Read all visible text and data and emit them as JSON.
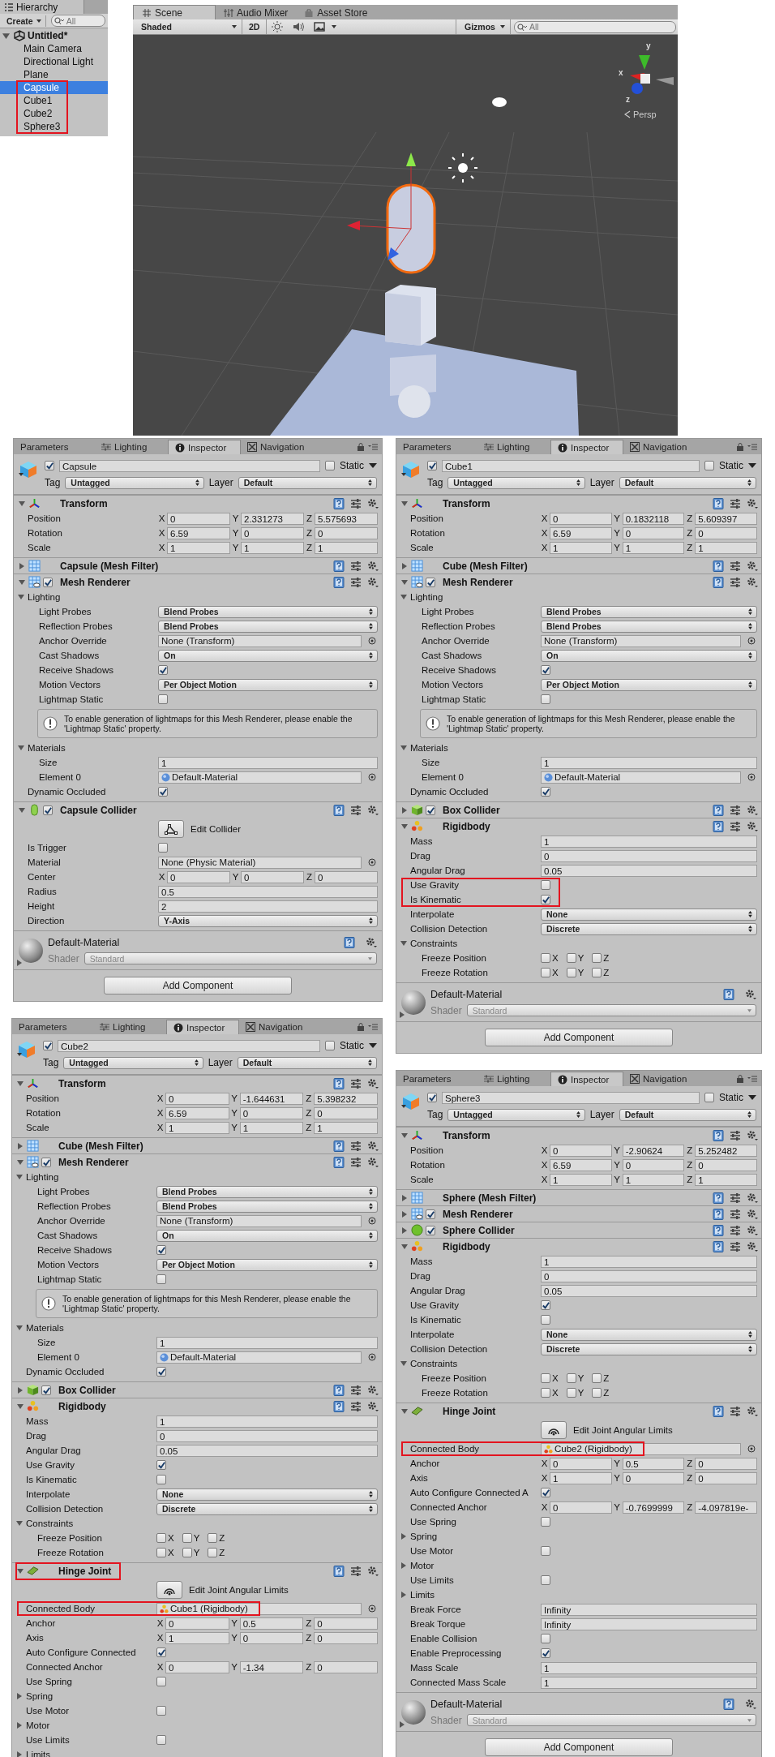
{
  "hierarchy": {
    "title": "Hierarchy",
    "create": "Create",
    "search_placeholder": "All",
    "tree": [
      {
        "label": "Untitled*",
        "expanded": true,
        "selected": false,
        "highlighted": false,
        "children": [
          {
            "label": "Main Camera",
            "selected": false,
            "highlighted": false
          },
          {
            "label": "Directional Light",
            "selected": false,
            "highlighted": false
          },
          {
            "label": "Plane",
            "selected": false,
            "highlighted": false
          },
          {
            "label": "Capsule",
            "selected": true,
            "highlighted": true
          },
          {
            "label": "Cube1",
            "selected": false,
            "highlighted": true
          },
          {
            "label": "Cube2",
            "selected": false,
            "highlighted": true
          },
          {
            "label": "Sphere3",
            "selected": false,
            "highlighted": true
          }
        ]
      }
    ]
  },
  "scene": {
    "tabs": [
      {
        "label": "Scene",
        "selected": true
      },
      {
        "label": "Audio Mixer",
        "selected": false
      },
      {
        "label": "Asset Store",
        "selected": false
      }
    ],
    "shading": "Shaded",
    "mode_2d": "2D",
    "gizmos": "Gizmos",
    "search_placeholder": "All",
    "axis_labels": [
      "y",
      "x",
      "z"
    ],
    "projection": "Persp"
  },
  "inspectors": [
    {
      "tabs": [
        {
          "label": "Parameters",
          "selected": false
        },
        {
          "label": "Lighting",
          "selected": false
        },
        {
          "label": "Inspector",
          "selected": true
        },
        {
          "label": "Navigation",
          "selected": false
        }
      ],
      "object": {
        "active": true,
        "name": "Capsule",
        "static": false,
        "static_label": "Static",
        "tag_label": "Tag",
        "tag": "Untagged",
        "layer_label": "Layer",
        "layer": "Default"
      },
      "components": [
        {
          "kind": "transform",
          "title": "Transform",
          "expanded": true,
          "highlighted": false,
          "rows": [
            {
              "kind": "vector",
              "label": "Position",
              "values": [
                {
                  "axis": "X",
                  "value": "0"
                },
                {
                  "axis": "Y",
                  "value": "2.331273"
                },
                {
                  "axis": "Z",
                  "value": "5.575693"
                }
              ]
            },
            {
              "kind": "vector",
              "label": "Rotation",
              "values": [
                {
                  "axis": "X",
                  "value": "6.59"
                },
                {
                  "axis": "Y",
                  "value": "0"
                },
                {
                  "axis": "Z",
                  "value": "0"
                }
              ]
            },
            {
              "kind": "vector",
              "label": "Scale",
              "values": [
                {
                  "axis": "X",
                  "value": "1"
                },
                {
                  "axis": "Y",
                  "value": "1"
                },
                {
                  "axis": "Z",
                  "value": "1"
                }
              ]
            }
          ]
        },
        {
          "kind": "mesh_filter",
          "title": "Capsule (Mesh Filter)",
          "expanded": false,
          "highlighted": false
        },
        {
          "kind": "mesh_renderer",
          "title": "Mesh Renderer",
          "expanded": true,
          "enabled": true,
          "highlighted": false,
          "rows": [
            {
              "kind": "foldout",
              "label": "Lighting",
              "expanded": true,
              "children": [
                {
                  "kind": "dropdown",
                  "label": "Light Probes",
                  "value": "Blend Probes"
                },
                {
                  "kind": "dropdown",
                  "label": "Reflection Probes",
                  "value": "Blend Probes"
                },
                {
                  "kind": "object",
                  "label": "Anchor Override",
                  "value": "None (Transform)"
                },
                {
                  "kind": "dropdown",
                  "label": "Cast Shadows",
                  "value": "On"
                },
                {
                  "kind": "checkbox",
                  "label": "Receive Shadows",
                  "checked": true
                },
                {
                  "kind": "dropdown",
                  "label": "Motion Vectors",
                  "value": "Per Object Motion"
                },
                {
                  "kind": "checkbox",
                  "label": "Lightmap Static",
                  "checked": false
                },
                {
                  "kind": "help",
                  "text": "To enable generation of lightmaps for this Mesh Renderer, please enable the 'Lightmap Static' property."
                }
              ]
            },
            {
              "kind": "foldout",
              "label": "Materials",
              "expanded": true,
              "children": [
                {
                  "kind": "field",
                  "label": "Size",
                  "value": "1"
                },
                {
                  "kind": "material_ref",
                  "label": "Element 0",
                  "value": "Default-Material"
                }
              ]
            },
            {
              "kind": "checkbox",
              "label": "Dynamic Occluded",
              "checked": true
            }
          ]
        },
        {
          "kind": "capsule_collider",
          "title": "Capsule Collider",
          "expanded": true,
          "enabled": true,
          "highlighted": false,
          "rows": [
            {
              "kind": "edit",
              "label": "Edit Collider"
            },
            {
              "kind": "checkbox",
              "label": "Is Trigger",
              "checked": false
            },
            {
              "kind": "object",
              "label": "Material",
              "value": "None (Physic Material)"
            },
            {
              "kind": "vector",
              "label": "Center",
              "values": [
                {
                  "axis": "X",
                  "value": "0"
                },
                {
                  "axis": "Y",
                  "value": "0"
                },
                {
                  "axis": "Z",
                  "value": "0"
                }
              ]
            },
            {
              "kind": "field",
              "label": "Radius",
              "value": "0.5"
            },
            {
              "kind": "field",
              "label": "Height",
              "value": "2"
            },
            {
              "kind": "dropdown",
              "label": "Direction",
              "value": "Y-Axis"
            }
          ]
        }
      ],
      "material": {
        "name": "Default-Material",
        "shader_label": "Shader",
        "shader": "Standard"
      },
      "add_component": "Add Component"
    },
    {
      "tabs": [
        {
          "label": "Parameters",
          "selected": false
        },
        {
          "label": "Lighting",
          "selected": false
        },
        {
          "label": "Inspector",
          "selected": true
        },
        {
          "label": "Navigation",
          "selected": false
        }
      ],
      "object": {
        "active": true,
        "name": "Cube1",
        "static": false,
        "static_label": "Static",
        "tag_label": "Tag",
        "tag": "Untagged",
        "layer_label": "Layer",
        "layer": "Default"
      },
      "components": [
        {
          "kind": "transform",
          "title": "Transform",
          "expanded": true,
          "highlighted": false,
          "rows": [
            {
              "kind": "vector",
              "label": "Position",
              "values": [
                {
                  "axis": "X",
                  "value": "0"
                },
                {
                  "axis": "Y",
                  "value": "0.1832118"
                },
                {
                  "axis": "Z",
                  "value": "5.609397"
                }
              ]
            },
            {
              "kind": "vector",
              "label": "Rotation",
              "values": [
                {
                  "axis": "X",
                  "value": "6.59"
                },
                {
                  "axis": "Y",
                  "value": "0"
                },
                {
                  "axis": "Z",
                  "value": "0"
                }
              ]
            },
            {
              "kind": "vector",
              "label": "Scale",
              "values": [
                {
                  "axis": "X",
                  "value": "1"
                },
                {
                  "axis": "Y",
                  "value": "1"
                },
                {
                  "axis": "Z",
                  "value": "1"
                }
              ]
            }
          ]
        },
        {
          "kind": "mesh_filter",
          "title": "Cube (Mesh Filter)",
          "expanded": false,
          "highlighted": false
        },
        {
          "kind": "mesh_renderer",
          "title": "Mesh Renderer",
          "expanded": true,
          "enabled": true,
          "highlighted": false,
          "rows": [
            {
              "kind": "foldout",
              "label": "Lighting",
              "expanded": true,
              "children": [
                {
                  "kind": "dropdown",
                  "label": "Light Probes",
                  "value": "Blend Probes"
                },
                {
                  "kind": "dropdown",
                  "label": "Reflection Probes",
                  "value": "Blend Probes"
                },
                {
                  "kind": "object",
                  "label": "Anchor Override",
                  "value": "None (Transform)"
                },
                {
                  "kind": "dropdown",
                  "label": "Cast Shadows",
                  "value": "On"
                },
                {
                  "kind": "checkbox",
                  "label": "Receive Shadows",
                  "checked": true
                },
                {
                  "kind": "dropdown",
                  "label": "Motion Vectors",
                  "value": "Per Object Motion"
                },
                {
                  "kind": "checkbox",
                  "label": "Lightmap Static",
                  "checked": false
                },
                {
                  "kind": "help",
                  "text": "To enable generation of lightmaps for this Mesh Renderer, please enable the 'Lightmap Static' property."
                }
              ]
            },
            {
              "kind": "foldout",
              "label": "Materials",
              "expanded": true,
              "children": [
                {
                  "kind": "field",
                  "label": "Size",
                  "value": "1"
                },
                {
                  "kind": "material_ref",
                  "label": "Element 0",
                  "value": "Default-Material"
                }
              ]
            },
            {
              "kind": "checkbox",
              "label": "Dynamic Occluded",
              "checked": true
            }
          ]
        },
        {
          "kind": "box_collider",
          "title": "Box Collider",
          "expanded": false,
          "enabled": true,
          "highlighted": false
        },
        {
          "kind": "rigidbody",
          "title": "Rigidbody",
          "expanded": true,
          "highlighted": false,
          "rows": [
            {
              "kind": "field",
              "label": "Mass",
              "value": "1"
            },
            {
              "kind": "field",
              "label": "Drag",
              "value": "0"
            },
            {
              "kind": "field",
              "label": "Angular Drag",
              "value": "0.05"
            },
            {
              "kind": "checkbox",
              "label": "Use Gravity",
              "checked": false,
              "highlighted": true
            },
            {
              "kind": "checkbox",
              "label": "Is Kinematic",
              "checked": true,
              "highlighted": true
            },
            {
              "kind": "dropdown",
              "label": "Interpolate",
              "value": "None"
            },
            {
              "kind": "dropdown",
              "label": "Collision Detection",
              "value": "Discrete"
            },
            {
              "kind": "foldout",
              "label": "Constraints",
              "expanded": true,
              "children": [
                {
                  "kind": "axes",
                  "label": "Freeze Position",
                  "axes": [
                    {
                      "label": "X",
                      "checked": false
                    },
                    {
                      "label": "Y",
                      "checked": false
                    },
                    {
                      "label": "Z",
                      "checked": false
                    }
                  ]
                },
                {
                  "kind": "axes",
                  "label": "Freeze Rotation",
                  "axes": [
                    {
                      "label": "X",
                      "checked": false
                    },
                    {
                      "label": "Y",
                      "checked": false
                    },
                    {
                      "label": "Z",
                      "checked": false
                    }
                  ]
                }
              ]
            }
          ]
        }
      ],
      "material": {
        "name": "Default-Material",
        "shader_label": "Shader",
        "shader": "Standard"
      },
      "add_component": "Add Component"
    },
    {
      "tabs": [
        {
          "label": "Parameters",
          "selected": false
        },
        {
          "label": "Lighting",
          "selected": false
        },
        {
          "label": "Inspector",
          "selected": true
        },
        {
          "label": "Navigation",
          "selected": false
        }
      ],
      "object": {
        "active": true,
        "name": "Cube2",
        "static": false,
        "static_label": "Static",
        "tag_label": "Tag",
        "tag": "Untagged",
        "layer_label": "Layer",
        "layer": "Default"
      },
      "components": [
        {
          "kind": "transform",
          "title": "Transform",
          "expanded": true,
          "highlighted": false,
          "rows": [
            {
              "kind": "vector",
              "label": "Position",
              "values": [
                {
                  "axis": "X",
                  "value": "0"
                },
                {
                  "axis": "Y",
                  "value": "-1.644631"
                },
                {
                  "axis": "Z",
                  "value": "5.398232"
                }
              ]
            },
            {
              "kind": "vector",
              "label": "Rotation",
              "values": [
                {
                  "axis": "X",
                  "value": "6.59"
                },
                {
                  "axis": "Y",
                  "value": "0"
                },
                {
                  "axis": "Z",
                  "value": "0"
                }
              ]
            },
            {
              "kind": "vector",
              "label": "Scale",
              "values": [
                {
                  "axis": "X",
                  "value": "1"
                },
                {
                  "axis": "Y",
                  "value": "1"
                },
                {
                  "axis": "Z",
                  "value": "1"
                }
              ]
            }
          ]
        },
        {
          "kind": "mesh_filter",
          "title": "Cube (Mesh Filter)",
          "expanded": false,
          "highlighted": false
        },
        {
          "kind": "mesh_renderer",
          "title": "Mesh Renderer",
          "expanded": true,
          "enabled": true,
          "highlighted": false,
          "rows": [
            {
              "kind": "foldout",
              "label": "Lighting",
              "expanded": true,
              "children": [
                {
                  "kind": "dropdown",
                  "label": "Light Probes",
                  "value": "Blend Probes"
                },
                {
                  "kind": "dropdown",
                  "label": "Reflection Probes",
                  "value": "Blend Probes"
                },
                {
                  "kind": "object",
                  "label": "Anchor Override",
                  "value": "None (Transform)"
                },
                {
                  "kind": "dropdown",
                  "label": "Cast Shadows",
                  "value": "On"
                },
                {
                  "kind": "checkbox",
                  "label": "Receive Shadows",
                  "checked": true
                },
                {
                  "kind": "dropdown",
                  "label": "Motion Vectors",
                  "value": "Per Object Motion"
                },
                {
                  "kind": "checkbox",
                  "label": "Lightmap Static",
                  "checked": false
                },
                {
                  "kind": "help",
                  "text": "To enable generation of lightmaps for this Mesh Renderer, please enable the 'Lightmap Static' property."
                }
              ]
            },
            {
              "kind": "foldout",
              "label": "Materials",
              "expanded": true,
              "children": [
                {
                  "kind": "field",
                  "label": "Size",
                  "value": "1"
                },
                {
                  "kind": "material_ref",
                  "label": "Element 0",
                  "value": "Default-Material"
                }
              ]
            },
            {
              "kind": "checkbox",
              "label": "Dynamic Occluded",
              "checked": true
            }
          ]
        },
        {
          "kind": "box_collider",
          "title": "Box Collider",
          "expanded": false,
          "enabled": true,
          "highlighted": false
        },
        {
          "kind": "rigidbody",
          "title": "Rigidbody",
          "expanded": true,
          "highlighted": false,
          "rows": [
            {
              "kind": "field",
              "label": "Mass",
              "value": "1"
            },
            {
              "kind": "field",
              "label": "Drag",
              "value": "0"
            },
            {
              "kind": "field",
              "label": "Angular Drag",
              "value": "0.05"
            },
            {
              "kind": "checkbox",
              "label": "Use Gravity",
              "checked": true
            },
            {
              "kind": "checkbox",
              "label": "Is Kinematic",
              "checked": false
            },
            {
              "kind": "dropdown",
              "label": "Interpolate",
              "value": "None"
            },
            {
              "kind": "dropdown",
              "label": "Collision Detection",
              "value": "Discrete"
            },
            {
              "kind": "foldout",
              "label": "Constraints",
              "expanded": true,
              "children": [
                {
                  "kind": "axes",
                  "label": "Freeze Position",
                  "axes": [
                    {
                      "label": "X",
                      "checked": false
                    },
                    {
                      "label": "Y",
                      "checked": false
                    },
                    {
                      "label": "Z",
                      "checked": false
                    }
                  ]
                },
                {
                  "kind": "axes",
                  "label": "Freeze Rotation",
                  "axes": [
                    {
                      "label": "X",
                      "checked": false
                    },
                    {
                      "label": "Y",
                      "checked": false
                    },
                    {
                      "label": "Z",
                      "checked": false
                    }
                  ]
                }
              ]
            }
          ]
        },
        {
          "kind": "hinge_joint",
          "title": "Hinge Joint",
          "expanded": true,
          "highlighted": true,
          "rows": [
            {
              "kind": "edit",
              "label": "Edit Joint Angular Limits"
            },
            {
              "kind": "rigidbody_ref",
              "label": "Connected Body",
              "value": "Cube1 (Rigidbody)",
              "highlighted": true
            },
            {
              "kind": "vector",
              "label": "Anchor",
              "values": [
                {
                  "axis": "X",
                  "value": "0"
                },
                {
                  "axis": "Y",
                  "value": "0.5"
                },
                {
                  "axis": "Z",
                  "value": "0"
                }
              ]
            },
            {
              "kind": "vector",
              "label": "Axis",
              "values": [
                {
                  "axis": "X",
                  "value": "1"
                },
                {
                  "axis": "Y",
                  "value": "0"
                },
                {
                  "axis": "Z",
                  "value": "0"
                }
              ]
            },
            {
              "kind": "checkbox",
              "label": "Auto Configure Connected",
              "checked": true
            },
            {
              "kind": "vector",
              "label": "Connected Anchor",
              "values": [
                {
                  "axis": "X",
                  "value": "0"
                },
                {
                  "axis": "Y",
                  "value": "-1.34"
                },
                {
                  "axis": "Z",
                  "value": "0"
                }
              ]
            },
            {
              "kind": "checkbox",
              "label": "Use Spring",
              "checked": false
            },
            {
              "kind": "foldout",
              "label": "Spring",
              "expanded": false
            },
            {
              "kind": "checkbox",
              "label": "Use Motor",
              "checked": false
            },
            {
              "kind": "foldout",
              "label": "Motor",
              "expanded": false
            },
            {
              "kind": "checkbox",
              "label": "Use Limits",
              "checked": false
            },
            {
              "kind": "foldout",
              "label": "Limits",
              "expanded": false
            }
          ]
        }
      ]
    },
    {
      "tabs": [
        {
          "label": "Parameters",
          "selected": false
        },
        {
          "label": "Lighting",
          "selected": false
        },
        {
          "label": "Inspector",
          "selected": true
        },
        {
          "label": "Navigation",
          "selected": false
        }
      ],
      "object": {
        "active": true,
        "name": "Sphere3",
        "static": false,
        "static_label": "Static",
        "tag_label": "Tag",
        "tag": "Untagged",
        "layer_label": "Layer",
        "layer": "Default"
      },
      "components": [
        {
          "kind": "transform",
          "title": "Transform",
          "expanded": true,
          "highlighted": false,
          "rows": [
            {
              "kind": "vector",
              "label": "Position",
              "values": [
                {
                  "axis": "X",
                  "value": "0"
                },
                {
                  "axis": "Y",
                  "value": "-2.90624"
                },
                {
                  "axis": "Z",
                  "value": "5.252482"
                }
              ]
            },
            {
              "kind": "vector",
              "label": "Rotation",
              "values": [
                {
                  "axis": "X",
                  "value": "6.59"
                },
                {
                  "axis": "Y",
                  "value": "0"
                },
                {
                  "axis": "Z",
                  "value": "0"
                }
              ]
            },
            {
              "kind": "vector",
              "label": "Scale",
              "values": [
                {
                  "axis": "X",
                  "value": "1"
                },
                {
                  "axis": "Y",
                  "value": "1"
                },
                {
                  "axis": "Z",
                  "value": "1"
                }
              ]
            }
          ]
        },
        {
          "kind": "mesh_filter",
          "title": "Sphere (Mesh Filter)",
          "expanded": false,
          "highlighted": false
        },
        {
          "kind": "mesh_renderer",
          "title": "Mesh Renderer",
          "expanded": false,
          "enabled": true,
          "highlighted": false
        },
        {
          "kind": "sphere_collider",
          "title": "Sphere Collider",
          "expanded": false,
          "enabled": true,
          "highlighted": false
        },
        {
          "kind": "rigidbody",
          "title": "Rigidbody",
          "expanded": true,
          "highlighted": false,
          "rows": [
            {
              "kind": "field",
              "label": "Mass",
              "value": "1"
            },
            {
              "kind": "field",
              "label": "Drag",
              "value": "0"
            },
            {
              "kind": "field",
              "label": "Angular Drag",
              "value": "0.05"
            },
            {
              "kind": "checkbox",
              "label": "Use Gravity",
              "checked": true
            },
            {
              "kind": "checkbox",
              "label": "Is Kinematic",
              "checked": false
            },
            {
              "kind": "dropdown",
              "label": "Interpolate",
              "value": "None"
            },
            {
              "kind": "dropdown",
              "label": "Collision Detection",
              "value": "Discrete"
            },
            {
              "kind": "foldout",
              "label": "Constraints",
              "expanded": true,
              "children": [
                {
                  "kind": "axes",
                  "label": "Freeze Position",
                  "axes": [
                    {
                      "label": "X",
                      "checked": false
                    },
                    {
                      "label": "Y",
                      "checked": false
                    },
                    {
                      "label": "Z",
                      "checked": false
                    }
                  ]
                },
                {
                  "kind": "axes",
                  "label": "Freeze Rotation",
                  "axes": [
                    {
                      "label": "X",
                      "checked": false
                    },
                    {
                      "label": "Y",
                      "checked": false
                    },
                    {
                      "label": "Z",
                      "checked": false
                    }
                  ]
                }
              ]
            }
          ]
        },
        {
          "kind": "hinge_joint",
          "title": "Hinge Joint",
          "expanded": true,
          "highlighted": false,
          "rows": [
            {
              "kind": "edit",
              "label": "Edit Joint Angular Limits"
            },
            {
              "kind": "rigidbody_ref",
              "label": "Connected Body",
              "value": "Cube2 (Rigidbody)",
              "highlighted": true
            },
            {
              "kind": "vector",
              "label": "Anchor",
              "values": [
                {
                  "axis": "X",
                  "value": "0"
                },
                {
                  "axis": "Y",
                  "value": "0.5"
                },
                {
                  "axis": "Z",
                  "value": "0"
                }
              ]
            },
            {
              "kind": "vector",
              "label": "Axis",
              "values": [
                {
                  "axis": "X",
                  "value": "1"
                },
                {
                  "axis": "Y",
                  "value": "0"
                },
                {
                  "axis": "Z",
                  "value": "0"
                }
              ]
            },
            {
              "kind": "checkbox",
              "label": "Auto Configure Connected A",
              "checked": true
            },
            {
              "kind": "vector",
              "label": "Connected Anchor",
              "values": [
                {
                  "axis": "X",
                  "value": "0"
                },
                {
                  "axis": "Y",
                  "value": "-0.7699999"
                },
                {
                  "axis": "Z",
                  "value": "-4.097819e-"
                }
              ]
            },
            {
              "kind": "checkbox",
              "label": "Use Spring",
              "checked": false
            },
            {
              "kind": "foldout",
              "label": "Spring",
              "expanded": false
            },
            {
              "kind": "checkbox",
              "label": "Use Motor",
              "checked": false
            },
            {
              "kind": "foldout",
              "label": "Motor",
              "expanded": false
            },
            {
              "kind": "checkbox",
              "label": "Use Limits",
              "checked": false
            },
            {
              "kind": "foldout",
              "label": "Limits",
              "expanded": false
            },
            {
              "kind": "field",
              "label": "Break Force",
              "value": "Infinity"
            },
            {
              "kind": "field",
              "label": "Break Torque",
              "value": "Infinity"
            },
            {
              "kind": "checkbox",
              "label": "Enable Collision",
              "checked": false
            },
            {
              "kind": "checkbox",
              "label": "Enable Preprocessing",
              "checked": true
            },
            {
              "kind": "field",
              "label": "Mass Scale",
              "value": "1"
            },
            {
              "kind": "field",
              "label": "Connected Mass Scale",
              "value": "1"
            }
          ]
        }
      ],
      "material": {
        "name": "Default-Material",
        "shader_label": "Shader",
        "shader": "Standard"
      },
      "add_component": "Add Component"
    }
  ]
}
